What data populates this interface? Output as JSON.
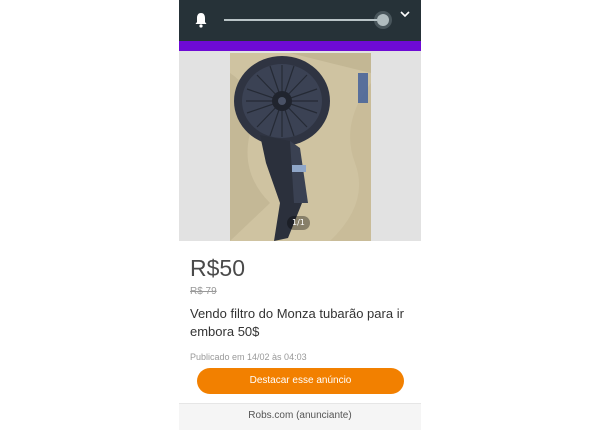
{
  "status_bar": {
    "bell_icon": "bell-icon",
    "volume_level": 0.99,
    "chevron_icon": "chevron-down-icon"
  },
  "colors": {
    "status_bar_bg": "#263238",
    "accent": "#6e0ad6",
    "cta": "#f28000"
  },
  "gallery": {
    "counter": "1/1"
  },
  "listing": {
    "price": "R$50",
    "old_price": "R$ 79",
    "title": "Vendo filtro do Monza tubarão para ir embora 50$",
    "published": "Publicado em 14/02 às 04:03"
  },
  "actions": {
    "promote_label": "Destacar esse anúncio"
  },
  "footer": {
    "advertiser": "Robs.com (anunciante)"
  }
}
